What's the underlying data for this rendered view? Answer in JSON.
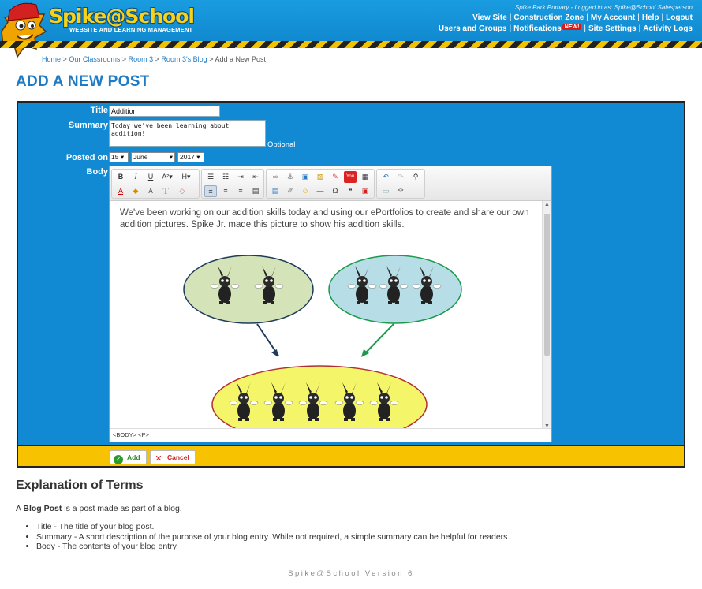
{
  "header": {
    "logo_text": "Spike@School",
    "logo_subtitle": "WEBSITE AND LEARNING MANAGEMENT",
    "login_info": "Spike Park Primary - Logged in as: Spike@School Salesperson",
    "nav_top": [
      "View Site",
      "Construction Zone",
      "My Account",
      "Help",
      "Logout"
    ],
    "nav_bottom": [
      "Users and Groups",
      "Notifications",
      "Site Settings",
      "Activity Logs"
    ],
    "new_badge": "NEW!",
    "separator": "|"
  },
  "breadcrumb": {
    "items": [
      "Home",
      "Our Classrooms",
      "Room 3",
      "Room 3's Blog"
    ],
    "current": "Add a New Post",
    "sep": ">"
  },
  "page_title": "ADD A NEW POST",
  "form": {
    "title_label": "Title",
    "title_value": "Addition",
    "summary_label": "Summary",
    "summary_value": "Today we've been learning about addition!",
    "optional_note": "Optional",
    "posted_on_label": "Posted on",
    "posted_day": "15",
    "posted_month": "June",
    "posted_year": "2017",
    "body_label": "Body",
    "body_text": "We've been working on our addition skills today and using our ePortfolios to create and share our own addition pictures. Spike Jr.  made this picture to show his addition skills.",
    "statusbar": "<BODY> <P>",
    "add_button": "Add",
    "cancel_button": "Cancel"
  },
  "explanation": {
    "title": "Explanation of Terms",
    "intro_prefix": "A",
    "intro_term": "Blog Post",
    "intro_suffix": "is a post made as part of a blog.",
    "terms": [
      "Title - The title of your blog post.",
      "Summary - A short description of the purpose of your blog entry. While not required, a simple summary can be helpful for readers.",
      "Body - The contents of your blog entry."
    ]
  },
  "footer": "Spike@School Version 6",
  "colors": {
    "accent": "#1f7bc4",
    "form_bg": "#118ad3",
    "bar": "#f7c200"
  }
}
